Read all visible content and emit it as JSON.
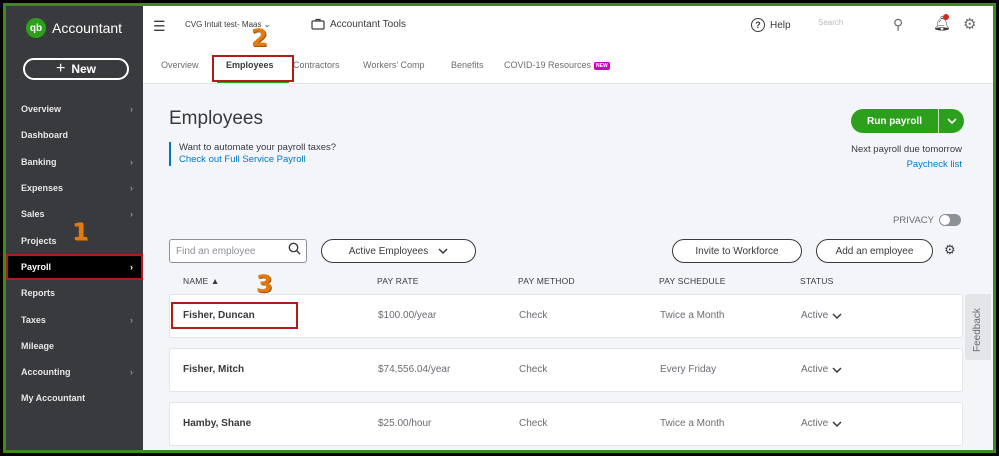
{
  "brand": {
    "logo_text": "qb",
    "name": "Accountant"
  },
  "sidebar": {
    "new_label": "New",
    "items": [
      {
        "label": "Overview",
        "has_chevron": true
      },
      {
        "label": "Dashboard",
        "has_chevron": false
      },
      {
        "label": "Banking",
        "has_chevron": true
      },
      {
        "label": "Expenses",
        "has_chevron": true
      },
      {
        "label": "Sales",
        "has_chevron": true
      },
      {
        "label": "Projects",
        "has_chevron": false
      },
      {
        "label": "Payroll",
        "has_chevron": true,
        "active": true
      },
      {
        "label": "Reports",
        "has_chevron": false
      },
      {
        "label": "Taxes",
        "has_chevron": true
      },
      {
        "label": "Mileage",
        "has_chevron": false
      },
      {
        "label": "Accounting",
        "has_chevron": true
      },
      {
        "label": "My Accountant",
        "has_chevron": false
      }
    ]
  },
  "topbar": {
    "company": "CVG Intuit test- Ma",
    "company_suffix": "as",
    "accountant_tools": "Accountant Tools",
    "help": "Help",
    "search_placeholder": "Search"
  },
  "tabs": [
    {
      "label": "Overview"
    },
    {
      "label": "Employees",
      "active": true
    },
    {
      "label": "Contractors"
    },
    {
      "label": "Workers' Comp"
    },
    {
      "label": "Benefits"
    },
    {
      "label": "COVID-19 Resources",
      "badge": "NEW"
    }
  ],
  "annotations": {
    "step1": "1",
    "step2": "2",
    "step3": "3"
  },
  "main": {
    "title": "Employees",
    "promo_text": "Want to automate your payroll taxes?",
    "promo_link": "Check out Full Service Payroll",
    "run_payroll": "Run payroll",
    "next_payroll": "Next payroll due tomorrow",
    "paycheck_list": "Paycheck list",
    "privacy": "PRIVACY",
    "find_placeholder": "Find an employee",
    "filter_label": "Active Employees",
    "invite_label": "Invite to Workforce",
    "add_label": "Add an employee",
    "feedback": "Feedback"
  },
  "table": {
    "headers": [
      "NAME ▲",
      "PAY RATE",
      "PAY METHOD",
      "PAY SCHEDULE",
      "STATUS"
    ],
    "rows": [
      {
        "name": "Fisher, Duncan",
        "rate": "$100.00/year",
        "method": "Check",
        "schedule": "Twice a Month",
        "status": "Active"
      },
      {
        "name": "Fisher, Mitch",
        "rate": "$74,556.04/year",
        "method": "Check",
        "schedule": "Every Friday",
        "status": "Active"
      },
      {
        "name": "Hamby, Shane",
        "rate": "$25.00/hour",
        "method": "Check",
        "schedule": "Twice a Month",
        "status": "Active"
      }
    ]
  },
  "colors": {
    "brand_green": "#2ca01c",
    "sidebar_bg": "#393a3d",
    "link_blue": "#0077c5",
    "highlight_red": "#b31b1b",
    "step_orange": "#e07b14"
  }
}
